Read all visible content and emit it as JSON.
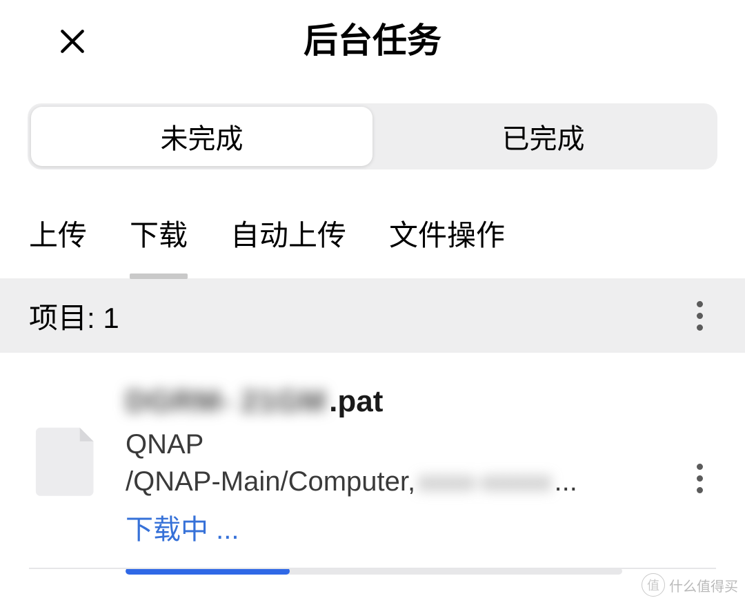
{
  "header": {
    "title": "后台任务"
  },
  "segmented": {
    "incomplete": "未完成",
    "complete": "已完成"
  },
  "subtabs": {
    "upload": "上传",
    "download": "下载",
    "auto_upload": "自动上传",
    "file_ops": "文件操作",
    "active": "download"
  },
  "summary": {
    "label": "项目:",
    "count": "1"
  },
  "item": {
    "name_blur_prefix": "DGRM- 21GM",
    "name_suffix": ".pat",
    "source_label": "QNAP",
    "path_prefix": "/QNAP-Main/Computer,",
    "path_blur_suffix": "xxxx-xxxxx",
    "path_tail": "...",
    "status": "下载中 ...",
    "progress_percent": 33
  },
  "watermark": {
    "badge": "值",
    "text": "什么值得买"
  }
}
